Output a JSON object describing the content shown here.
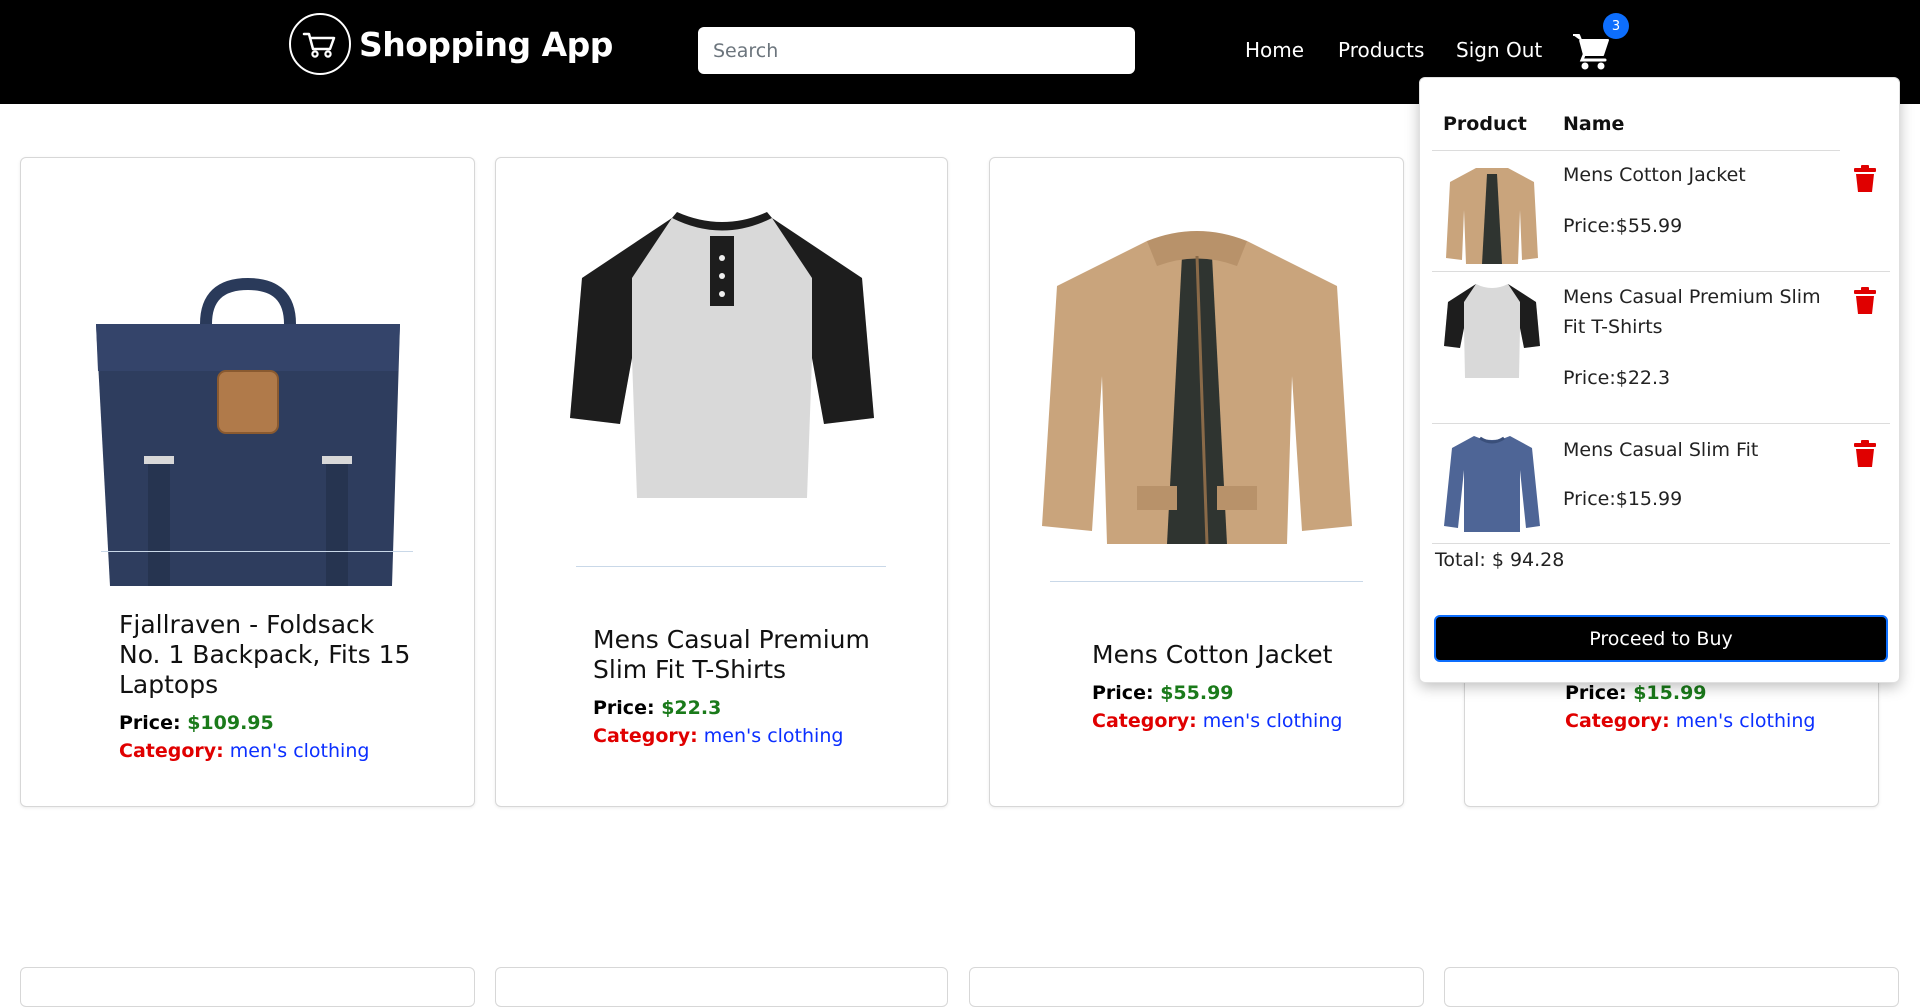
{
  "header": {
    "brand_title": "Shopping App",
    "search_placeholder": "Search",
    "nav": [
      "Home",
      "Products",
      "Sign Out"
    ],
    "cart_count": "3"
  },
  "products": [
    {
      "title": "Fjallraven - Foldsack No. 1 Backpack, Fits 15 Laptops",
      "price_label": "Price:",
      "price": "$109.95",
      "category_label": "Category:",
      "category": "men's clothing",
      "image": "backpack"
    },
    {
      "title": "Mens Casual Premium Slim Fit T-Shirts",
      "price_label": "Price:",
      "price": "$22.3",
      "category_label": "Category:",
      "category": "men's clothing",
      "image": "tshirt"
    },
    {
      "title": "Mens Cotton Jacket",
      "price_label": "Price:",
      "price": "$55.99",
      "category_label": "Category:",
      "category": "men's clothing",
      "image": "jacket"
    },
    {
      "title": "",
      "price_label": "Price:",
      "price": "$15.99",
      "category_label": "Category:",
      "category": "men's clothing",
      "image": "none"
    }
  ],
  "cart": {
    "col_product": "Product",
    "col_name": "Name",
    "items": [
      {
        "name": "Mens Cotton Jacket",
        "price": "Price:$55.99"
      },
      {
        "name": "Mens Casual Premium Slim Fit T-Shirts",
        "price": "Price:$22.3"
      },
      {
        "name": "Mens Casual Slim Fit",
        "price": "Price:$15.99"
      }
    ],
    "total": "Total: $ 94.28",
    "buy_label": "Proceed to Buy"
  },
  "colors": {
    "header_bg": "#000000",
    "price_green": "#1a7a1a",
    "category_red": "#e00000",
    "category_blue": "#0b2fff",
    "badge_blue": "#0d6efd",
    "trash_red": "#e00000"
  }
}
